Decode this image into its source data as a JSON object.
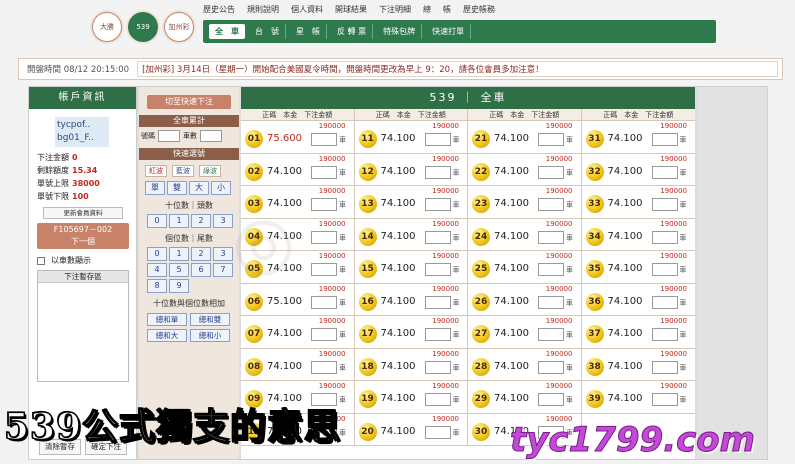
{
  "nav": {
    "circles": [
      {
        "label": "大勝",
        "active": false
      },
      {
        "label": "539",
        "active": true
      },
      {
        "label": "加州彩",
        "active": false
      }
    ],
    "top_menu": [
      "歷史公告",
      "規則說明",
      "個人資料",
      "開球結果",
      "下注明細",
      "總",
      "帳",
      "歷史帳務"
    ],
    "tabs": [
      {
        "label": "全　車",
        "active": true
      },
      {
        "label": "台　號",
        "active": false
      },
      {
        "label": "星　帳",
        "active": false
      },
      {
        "label": "反 轉 票",
        "active": false
      },
      {
        "label": "特殊包牌",
        "active": false
      },
      {
        "label": "快速打單",
        "active": false
      }
    ]
  },
  "notice": {
    "time": "開盤時間 08/12 20:15:00",
    "message": "[加州彩] 3月14日（星期一）開始配合美國夏令時間，開盤時間更改為早上 9：20，請各位會員多加注意！"
  },
  "account": {
    "header": "帳戶資訊",
    "user_line1": "tycpof..",
    "user_line2": "bg01_F..",
    "rows": [
      {
        "label": "下注金額",
        "value": "0"
      },
      {
        "label": "剩餘額度",
        "value": "15.34"
      },
      {
        "label": "單號上限",
        "value": "38000"
      },
      {
        "label": "單號下限",
        "value": "100"
      }
    ],
    "update_btn": "更新會員資料",
    "order_btn_line1": "F105697－002",
    "order_btn_line2": "下一個",
    "checkbox_label": "以車數顯示",
    "temp_header": "下注暫存區",
    "clear_btn": "清除暫存",
    "confirm_btn": "確定下注"
  },
  "quick": {
    "switch_btn": "切至快速下注",
    "section1": "全車累計",
    "num_label": "號碼",
    "amount_label": "車數",
    "section2": "快速選號",
    "colors": [
      {
        "label": "紅波",
        "tone": "red"
      },
      {
        "label": "藍波",
        "tone": "blue"
      },
      {
        "label": "綠波",
        "tone": "green"
      }
    ],
    "parity": [
      "單",
      "雙",
      "大",
      "小"
    ],
    "tens_label": "十位數｜頭數",
    "tens_digits": [
      "0",
      "1",
      "2",
      "3"
    ],
    "units_label": "個位數｜尾數",
    "units_digits": [
      "0",
      "1",
      "2",
      "3",
      "4",
      "5",
      "6",
      "7",
      "8",
      "9"
    ],
    "sum_label": "十位數與個位數相加",
    "sums": [
      "總和單",
      "總和雙",
      "總和大",
      "總和小"
    ]
  },
  "grid": {
    "title": "539 ｜ 全車",
    "col_header": "正碼　本金　下注金額",
    "max": "190000",
    "unit": "車",
    "columns": [
      [
        {
          "n": "01",
          "odds": "75.600",
          "red": true
        },
        {
          "n": "02",
          "odds": "74.100"
        },
        {
          "n": "03",
          "odds": "74.100"
        },
        {
          "n": "04",
          "odds": "74.100"
        },
        {
          "n": "05",
          "odds": "74.100"
        },
        {
          "n": "06",
          "odds": "75.100"
        },
        {
          "n": "07",
          "odds": "74.100"
        },
        {
          "n": "08",
          "odds": "74.100"
        },
        {
          "n": "09",
          "odds": "74.100"
        },
        {
          "n": "10",
          "odds": "74.100"
        }
      ],
      [
        {
          "n": "11",
          "odds": "74.100"
        },
        {
          "n": "12",
          "odds": "74.100"
        },
        {
          "n": "13",
          "odds": "74.100"
        },
        {
          "n": "14",
          "odds": "74.100"
        },
        {
          "n": "15",
          "odds": "74.100"
        },
        {
          "n": "16",
          "odds": "74.100"
        },
        {
          "n": "17",
          "odds": "74.100"
        },
        {
          "n": "18",
          "odds": "74.100"
        },
        {
          "n": "19",
          "odds": "74.100"
        },
        {
          "n": "20",
          "odds": "74.100"
        }
      ],
      [
        {
          "n": "21",
          "odds": "74.100"
        },
        {
          "n": "22",
          "odds": "74.100"
        },
        {
          "n": "23",
          "odds": "74.100"
        },
        {
          "n": "24",
          "odds": "74.100"
        },
        {
          "n": "25",
          "odds": "74.100"
        },
        {
          "n": "26",
          "odds": "74.100"
        },
        {
          "n": "27",
          "odds": "74.100"
        },
        {
          "n": "28",
          "odds": "74.100"
        },
        {
          "n": "29",
          "odds": "74.100"
        },
        {
          "n": "30",
          "odds": "74.100"
        }
      ],
      [
        {
          "n": "31",
          "odds": "74.100"
        },
        {
          "n": "32",
          "odds": "74.100"
        },
        {
          "n": "33",
          "odds": "74.100"
        },
        {
          "n": "34",
          "odds": "74.100"
        },
        {
          "n": "35",
          "odds": "74.100"
        },
        {
          "n": "36",
          "odds": "74.100"
        },
        {
          "n": "37",
          "odds": "74.100"
        },
        {
          "n": "38",
          "odds": "74.100"
        },
        {
          "n": "39",
          "odds": "74.100"
        }
      ]
    ]
  },
  "overlay": {
    "caption": "539公式獨支的意思",
    "brand": "tyc1799.com"
  }
}
